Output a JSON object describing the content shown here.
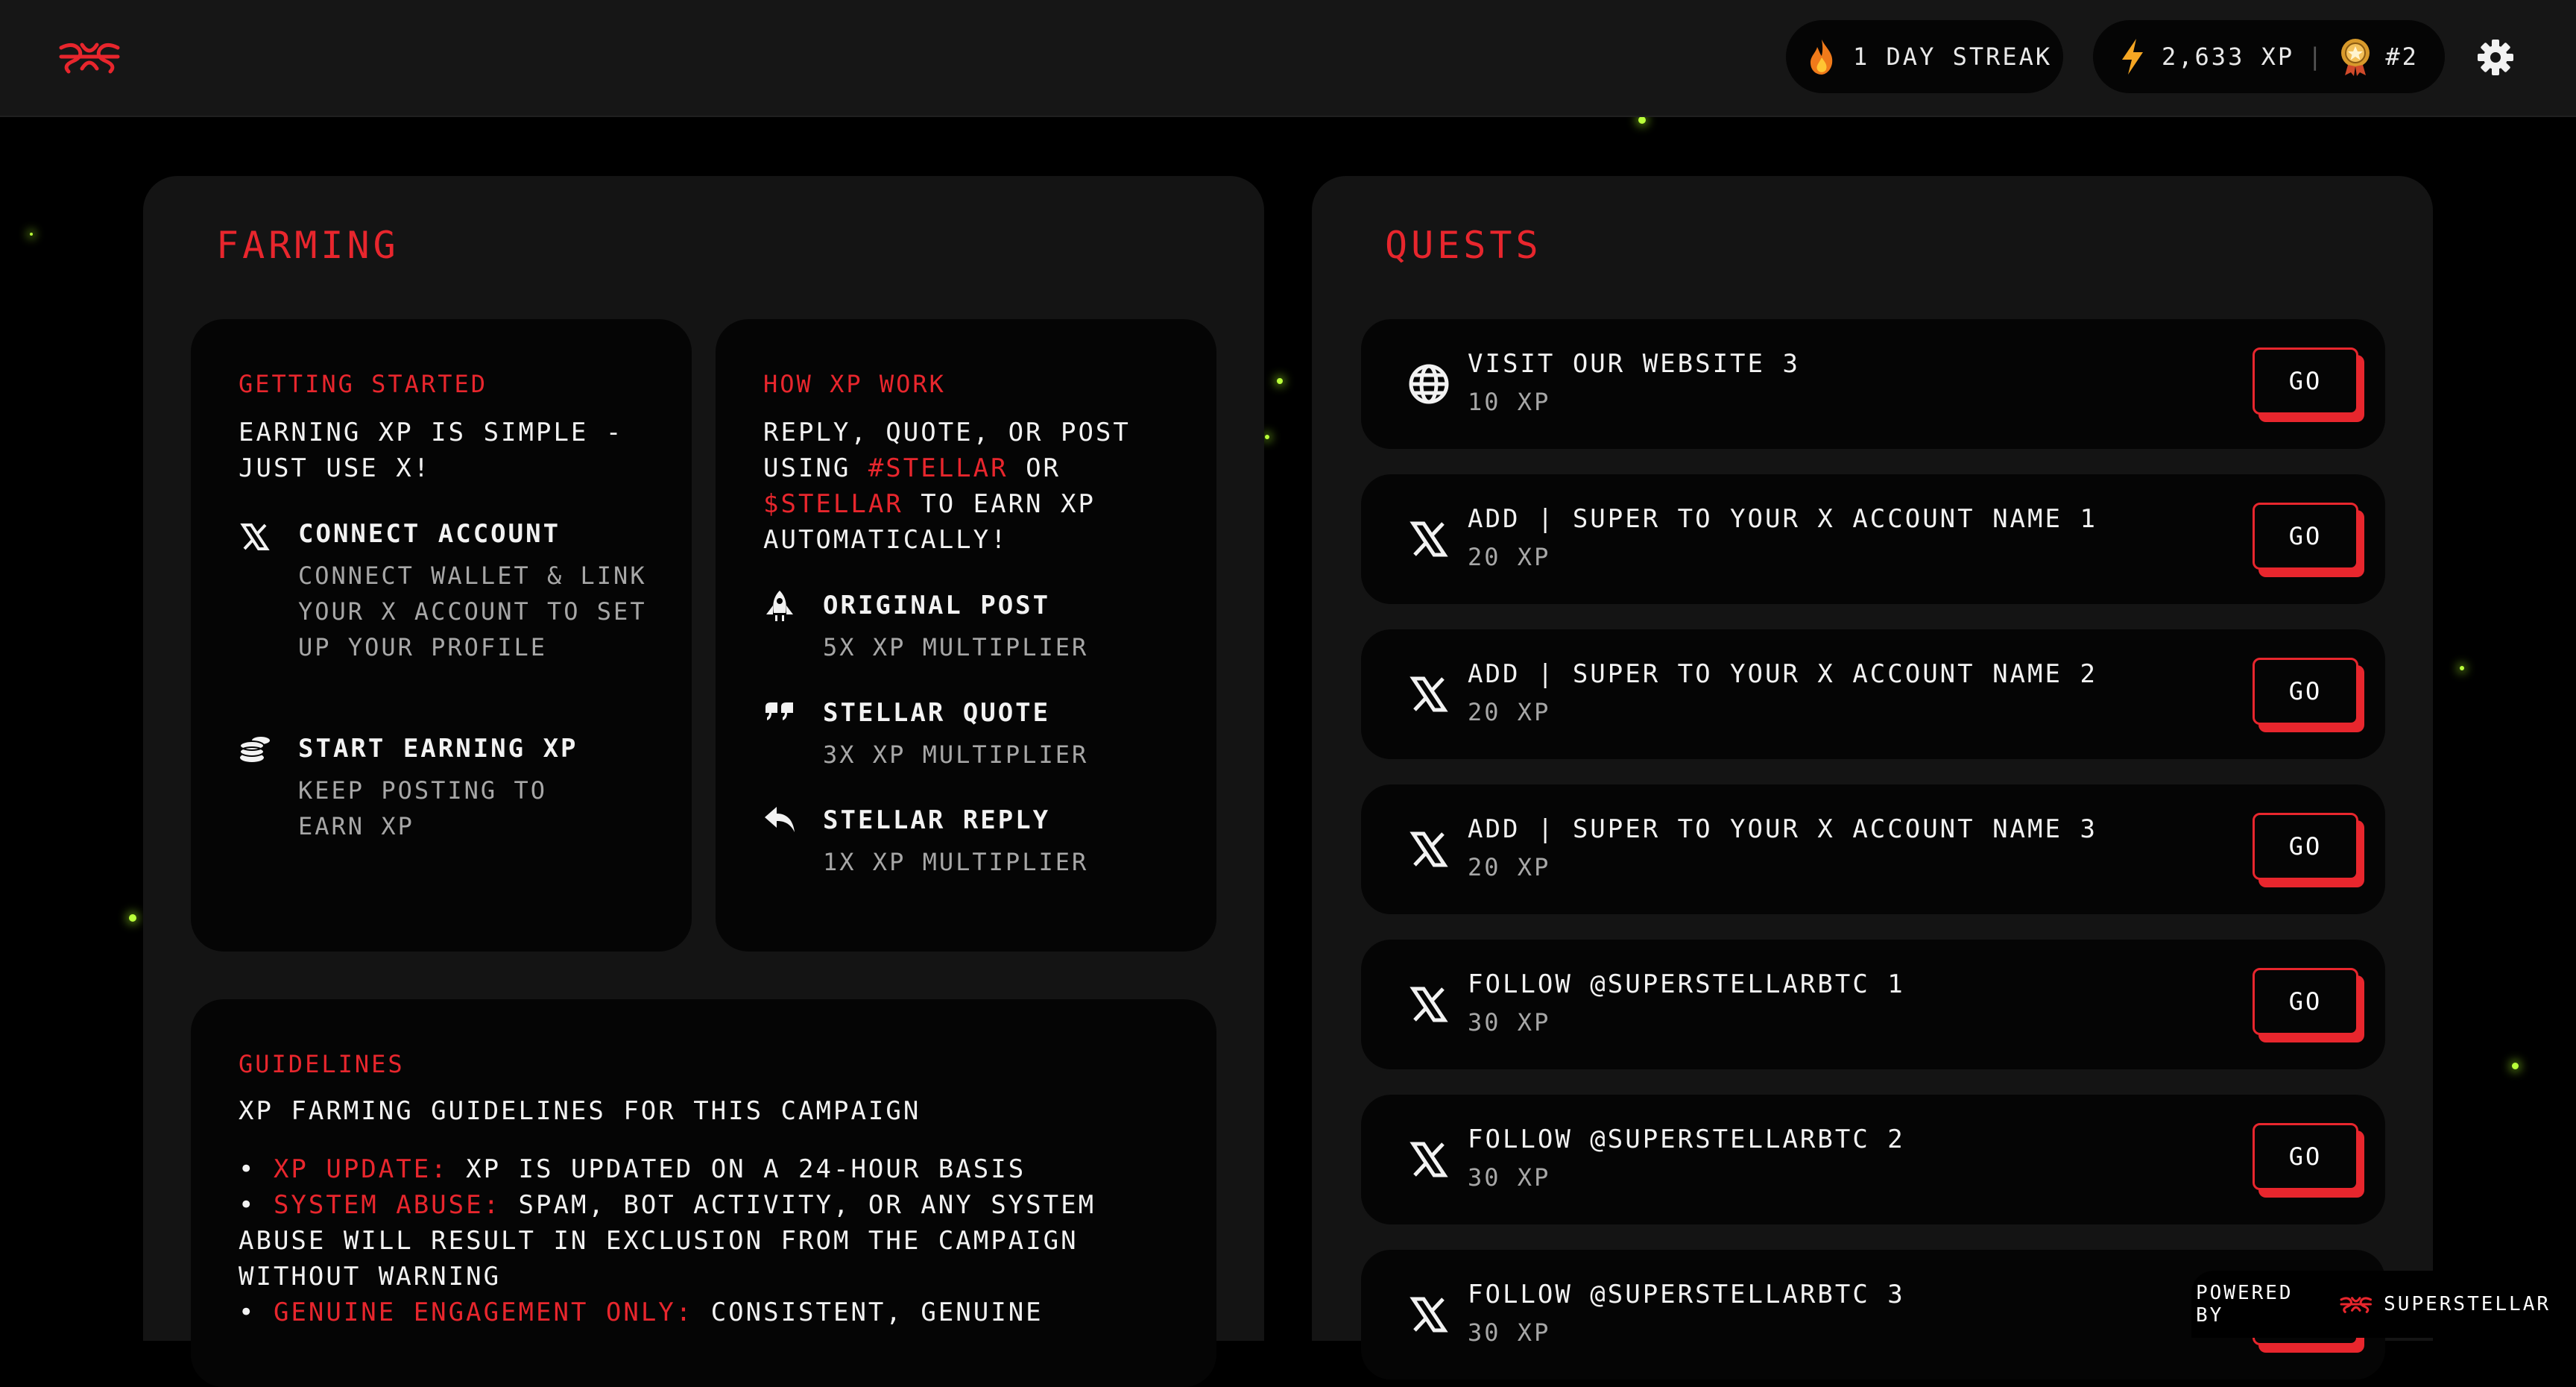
{
  "header": {
    "streak": "1 DAY STREAK",
    "xp": "2,633 XP",
    "divider": "|",
    "rank": "#2"
  },
  "farming": {
    "title": "FARMING",
    "getting_started": {
      "heading": "GETTING STARTED",
      "intro": "EARNING XP IS SIMPLE - JUST USE X!",
      "steps": [
        {
          "title": "CONNECT ACCOUNT",
          "desc": "CONNECT WALLET & LINK YOUR X ACCOUNT TO SET UP YOUR PROFILE",
          "icon": "x-logo-icon"
        },
        {
          "title": "START EARNING XP",
          "desc": "KEEP POSTING TO EARN XP",
          "icon": "coins-icon"
        }
      ]
    },
    "how_xp_works": {
      "heading": "HOW XP WORK",
      "line1": "REPLY, QUOTE, OR POST USING ",
      "tag1": "#STELLAR",
      "or": " OR ",
      "tag2": "$STELLAR",
      "line2": " TO EARN XP AUTOMATICALLY!",
      "items": [
        {
          "title": "ORIGINAL POST",
          "mult": "5X XP MULTIPLIER",
          "icon": "rocket-icon"
        },
        {
          "title": "STELLAR QUOTE",
          "mult": "3X XP MULTIPLIER",
          "icon": "quote-icon"
        },
        {
          "title": "STELLAR REPLY",
          "mult": "1X XP MULTIPLIER",
          "icon": "reply-icon"
        }
      ]
    },
    "guidelines": {
      "heading": "GUIDELINES",
      "intro": "XP FARMING GUIDELINES FOR THIS CAMPAIGN",
      "items": [
        {
          "label": "XP UPDATE:",
          "text": " XP IS UPDATED ON A 24-HOUR BASIS"
        },
        {
          "label": "SYSTEM ABUSE:",
          "text": " SPAM, BOT ACTIVITY, OR ANY SYSTEM ABUSE WILL RESULT IN EXCLUSION FROM THE CAMPAIGN WITHOUT WARNING"
        },
        {
          "label": "GENUINE ENGAGEMENT ONLY:",
          "text": " CONSISTENT, GENUINE"
        }
      ]
    }
  },
  "quests": {
    "title": "QUESTS",
    "button_label": "GO",
    "items": [
      {
        "title": "VISIT OUR WEBSITE 3",
        "xp": "10 XP",
        "icon": "globe-icon"
      },
      {
        "title": "ADD | SUPER TO YOUR X ACCOUNT NAME 1",
        "xp": "20 XP",
        "icon": "x-logo-icon"
      },
      {
        "title": "ADD | SUPER TO YOUR X ACCOUNT NAME 2",
        "xp": "20 XP",
        "icon": "x-logo-icon"
      },
      {
        "title": "ADD | SUPER TO YOUR X ACCOUNT NAME 3",
        "xp": "20 XP",
        "icon": "x-logo-icon"
      },
      {
        "title": "FOLLOW @SUPERSTELLARBTC 1",
        "xp": "30 XP",
        "icon": "x-logo-icon"
      },
      {
        "title": "FOLLOW @SUPERSTELLARBTC 2",
        "xp": "30 XP",
        "icon": "x-logo-icon"
      },
      {
        "title": "FOLLOW @SUPERSTELLARBTC 3",
        "xp": "30 XP",
        "icon": "x-logo-icon"
      }
    ]
  },
  "footer": {
    "powered_by": "POWERED BY",
    "brand": "SUPERSTELLAR"
  },
  "colors": {
    "accent": "#e8262d",
    "background": "#000000",
    "panel": "#141414",
    "card": "#050505"
  }
}
